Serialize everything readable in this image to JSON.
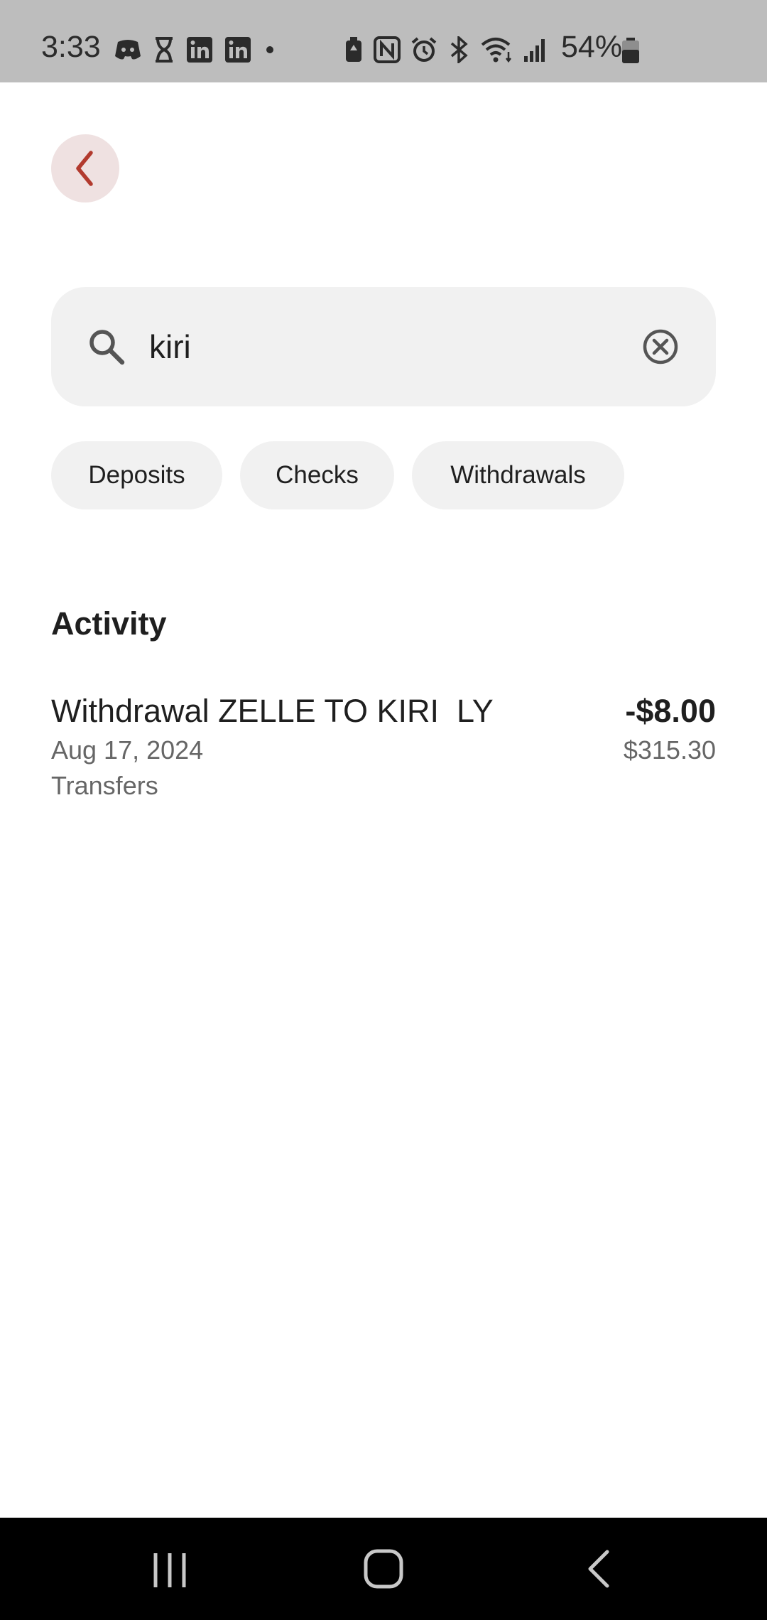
{
  "status_bar": {
    "time": "3:33",
    "battery": "54%",
    "left_icons": [
      "discord-icon",
      "hourglass-icon",
      "linkedin-icon",
      "linkedin-icon",
      "dot-icon"
    ],
    "right_icons": [
      "battery-saver-icon",
      "nfc-icon",
      "alarm-icon",
      "bluetooth-icon",
      "wifi-icon",
      "signal-icon"
    ]
  },
  "header": {
    "back_icon": "chevron-left-icon",
    "accent_color": "#b23a2e"
  },
  "search": {
    "value": "kiri",
    "placeholder": "Search"
  },
  "filters": [
    {
      "label": "Deposits"
    },
    {
      "label": "Checks"
    },
    {
      "label": "Withdrawals"
    }
  ],
  "activity": {
    "title": "Activity",
    "transactions": [
      {
        "description": "Withdrawal ZELLE TO KIRI  LY",
        "date": "Aug 17, 2024",
        "category": "Transfers",
        "amount": "-$8.00",
        "balance": "$315.30"
      }
    ]
  },
  "nav_bar": {
    "icons": [
      "recents-icon",
      "home-icon",
      "back-icon"
    ]
  }
}
